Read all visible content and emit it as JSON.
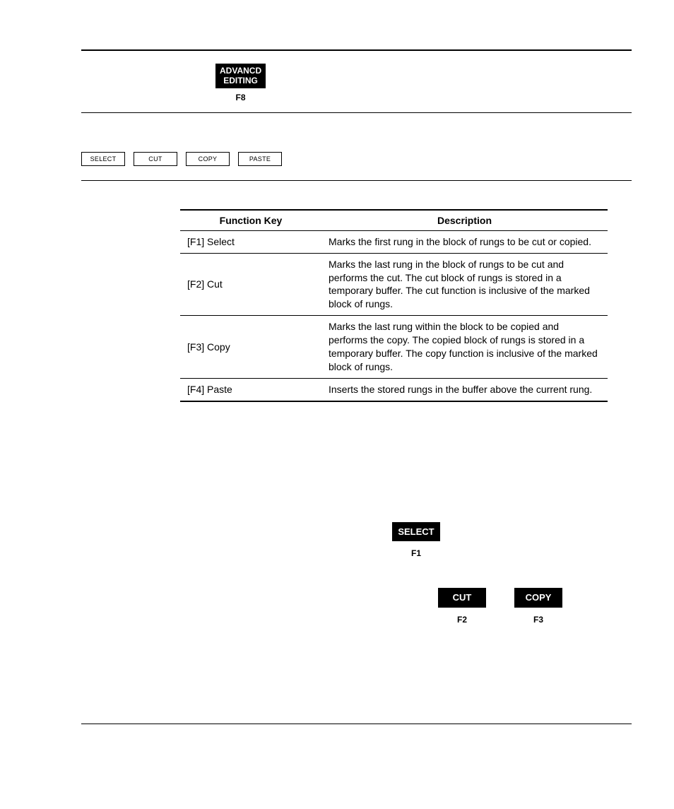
{
  "top_key": {
    "line1": "ADVANCD",
    "line2": "EDITING",
    "fn": "F8"
  },
  "buttons": [
    "SELECT",
    "CUT",
    "COPY",
    "PASTE"
  ],
  "table": {
    "headers": {
      "col1": "Function Key",
      "col2": "Description"
    },
    "rows": [
      {
        "fk": "[F1] Select",
        "desc": "Marks the first rung in the block of rungs to be cut or copied."
      },
      {
        "fk": "[F2] Cut",
        "desc": "Marks the last rung in the block of rungs to be cut and performs the cut.  The cut block of rungs is stored in a temporary buffer.  The cut function is inclusive of the marked block of rungs."
      },
      {
        "fk": "[F3] Copy",
        "desc": "Marks the last rung within the block to be copied and performs the copy.  The copied block of rungs is stored in a temporary buffer.  The copy function is inclusive of the marked block of rungs."
      },
      {
        "fk": "[F4] Paste",
        "desc": "Inserts the stored rungs in the buffer above the current rung."
      }
    ]
  },
  "inline_select": {
    "label": "SELECT",
    "fn": "F1"
  },
  "inline_cut": {
    "label": "CUT",
    "fn": "F2"
  },
  "inline_copy": {
    "label": "COPY",
    "fn": "F3"
  }
}
